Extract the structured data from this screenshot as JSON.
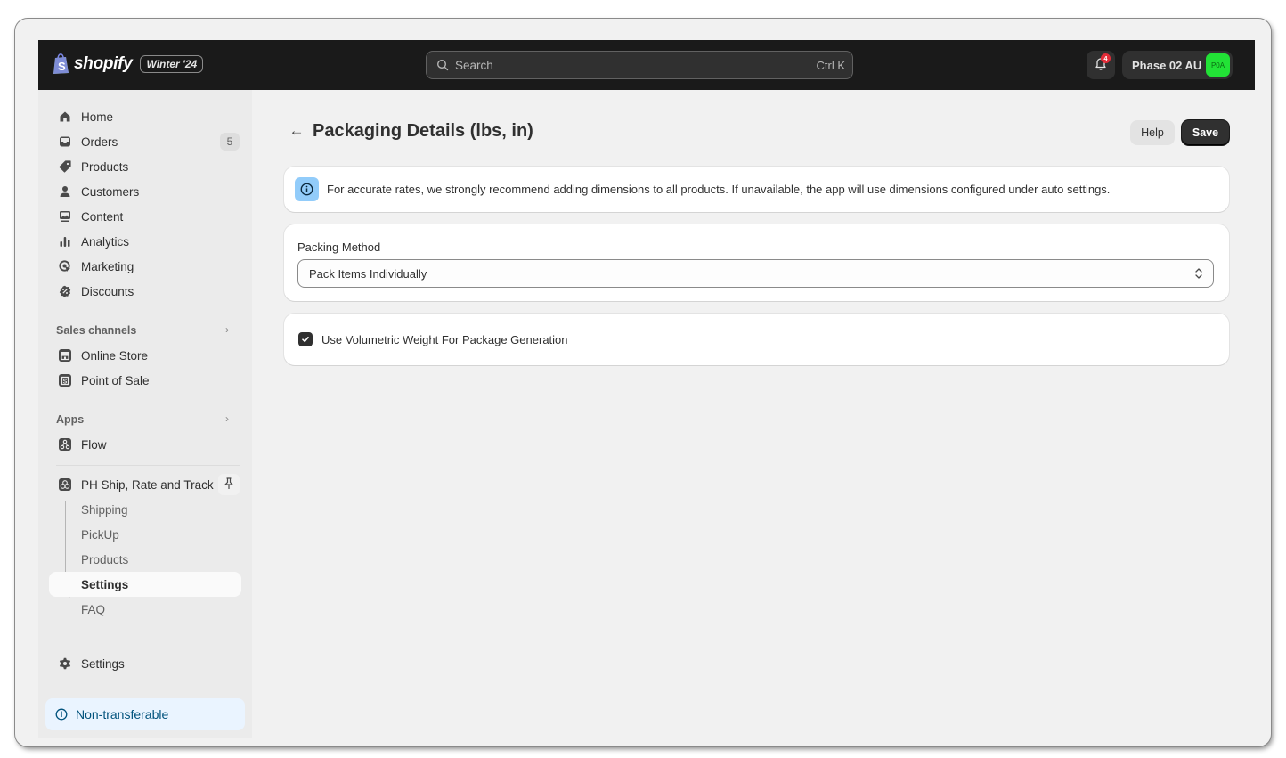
{
  "topbar": {
    "brand": "shopify",
    "version_badge": "Winter '24",
    "search": {
      "placeholder": "Search",
      "shortcut": "Ctrl K"
    },
    "notifications": {
      "count": "4",
      "icon": "bell-icon"
    },
    "store": {
      "name": "Phase 02 AU",
      "avatar_initials": "P0A",
      "avatar_color": "#22e236"
    }
  },
  "sidebar": {
    "primary": [
      {
        "label": "Home",
        "icon": "home-icon"
      },
      {
        "label": "Orders",
        "icon": "orders-inbox-icon",
        "badge": "5"
      },
      {
        "label": "Products",
        "icon": "tag-icon"
      },
      {
        "label": "Customers",
        "icon": "person-icon"
      },
      {
        "label": "Content",
        "icon": "content-image-icon"
      },
      {
        "label": "Analytics",
        "icon": "bar-chart-icon"
      },
      {
        "label": "Marketing",
        "icon": "target-icon"
      },
      {
        "label": "Discounts",
        "icon": "discount-badge-icon"
      }
    ],
    "sales_channels": {
      "title": "Sales channels",
      "items": [
        {
          "label": "Online Store",
          "icon": "storefront-icon"
        },
        {
          "label": "Point of Sale",
          "icon": "pos-bag-icon"
        }
      ]
    },
    "apps": {
      "title": "Apps",
      "items": [
        {
          "label": "Flow",
          "icon": "flow-icon"
        }
      ]
    },
    "pinned_app": {
      "label": "PH Ship, Rate and Track",
      "icon": "app-icon",
      "pin_icon": "pin-icon",
      "sub_items": [
        {
          "label": "Shipping",
          "active": false
        },
        {
          "label": "PickUp",
          "active": false
        },
        {
          "label": "Products",
          "active": false
        },
        {
          "label": "Settings",
          "active": true
        },
        {
          "label": "FAQ",
          "active": false
        }
      ]
    },
    "settings": {
      "label": "Settings",
      "icon": "gear-icon"
    },
    "banner": {
      "label": "Non-transferable",
      "icon": "info-icon"
    }
  },
  "page": {
    "title": "Packaging Details (lbs, in)",
    "help_label": "Help",
    "save_label": "Save",
    "info_banner": "For accurate rates, we strongly recommend adding dimensions to all products. If unavailable, the app will use dimensions configured under auto settings.",
    "packing_method": {
      "label": "Packing Method",
      "selected": "Pack Items Individually"
    },
    "volumetric": {
      "label": "Use Volumetric Weight For Package Generation",
      "checked": true
    }
  }
}
